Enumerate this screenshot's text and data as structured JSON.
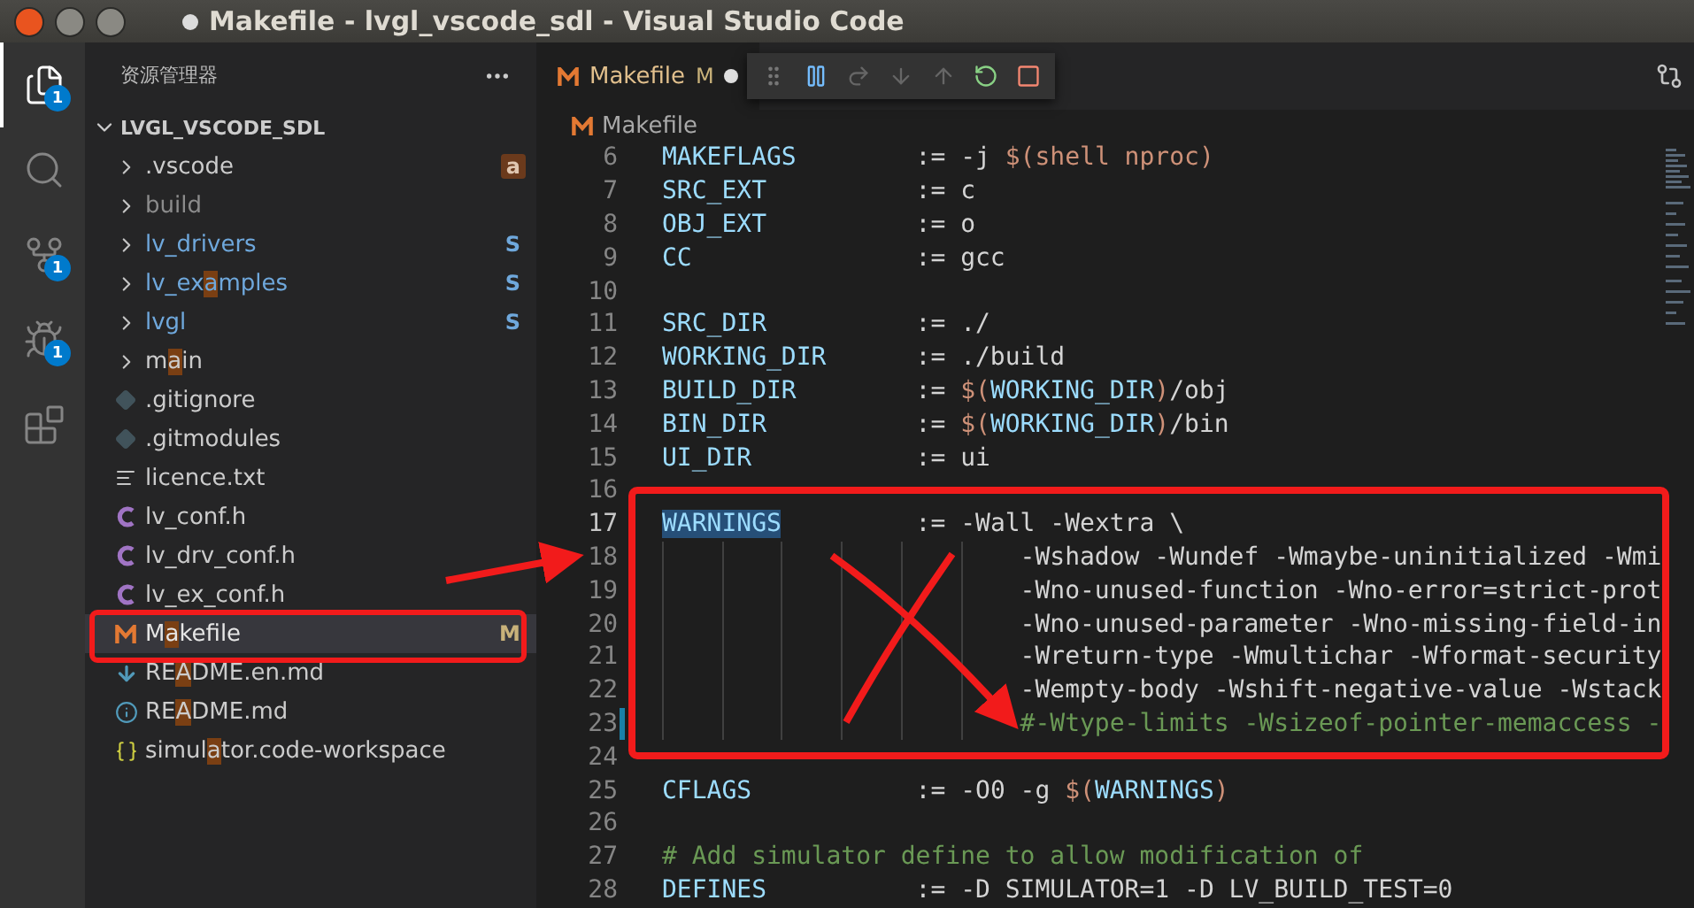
{
  "window": {
    "title": "Makefile - lvgl_vscode_sdl - Visual Studio Code",
    "unsaved": true
  },
  "activity_bar": [
    {
      "kind": "files",
      "selected": true,
      "badge": "1"
    },
    {
      "kind": "search",
      "selected": false
    },
    {
      "kind": "source-control",
      "selected": false,
      "badge": "1"
    },
    {
      "kind": "debug",
      "selected": false,
      "badge": "1"
    },
    {
      "kind": "extensions",
      "selected": false
    }
  ],
  "sidebar": {
    "title": "资源管理器",
    "section": {
      "title": "LVGL_VSCODE_SDL",
      "expanded": true
    },
    "items": [
      {
        "kind": "folder",
        "label_parts": [
          ".vscode"
        ],
        "ignored": false,
        "submodule": false,
        "modified": false,
        "decoration": "a",
        "selected": false
      },
      {
        "kind": "folder",
        "label_parts": [
          "build"
        ],
        "ignored": true,
        "submodule": false,
        "modified": false,
        "selected": false
      },
      {
        "kind": "folder",
        "label_parts": [
          "lv_drivers"
        ],
        "ignored": false,
        "submodule": true,
        "modified": false,
        "decoration": "S",
        "selected": false
      },
      {
        "kind": "folder",
        "label_parts": [
          "lv_ex",
          "a",
          "mples"
        ],
        "ignored": false,
        "submodule": true,
        "modified": false,
        "decoration": "S",
        "selected": false
      },
      {
        "kind": "folder",
        "label_parts": [
          "lvgl"
        ],
        "ignored": false,
        "submodule": true,
        "modified": false,
        "decoration": "S",
        "selected": false
      },
      {
        "kind": "folder",
        "label_parts": [
          "m",
          "a",
          "in"
        ],
        "ignored": false,
        "submodule": false,
        "modified": false,
        "selected": false
      },
      {
        "kind": "git",
        "label_parts": [
          ".gitignore"
        ],
        "ignored": false,
        "submodule": false,
        "modified": false,
        "selected": false
      },
      {
        "kind": "git",
        "label_parts": [
          ".gitmodules"
        ],
        "ignored": false,
        "submodule": false,
        "modified": false,
        "selected": false
      },
      {
        "kind": "text",
        "label_parts": [
          "licence.txt"
        ],
        "ignored": false,
        "submodule": false,
        "modified": false,
        "selected": false
      },
      {
        "kind": "c",
        "label_parts": [
          "lv_conf.h"
        ],
        "ignored": false,
        "submodule": false,
        "modified": false,
        "selected": false
      },
      {
        "kind": "c",
        "label_parts": [
          "lv_drv_conf.h"
        ],
        "ignored": false,
        "submodule": false,
        "modified": false,
        "selected": false
      },
      {
        "kind": "c",
        "label_parts": [
          "lv_ex_conf.h"
        ],
        "ignored": false,
        "submodule": false,
        "modified": false,
        "selected": false
      },
      {
        "kind": "make",
        "label_parts": [
          "M",
          "a",
          "kefile"
        ],
        "ignored": false,
        "submodule": false,
        "modified": true,
        "decoration": "M",
        "selected": true
      },
      {
        "kind": "download",
        "label_parts": [
          "RE",
          "A",
          "DME.en.md"
        ],
        "ignored": false,
        "submodule": false,
        "modified": false,
        "selected": false
      },
      {
        "kind": "info",
        "label_parts": [
          "RE",
          "A",
          "DME.md"
        ],
        "ignored": false,
        "submodule": false,
        "modified": false,
        "selected": false
      },
      {
        "kind": "json",
        "label_parts": [
          "simul",
          "a",
          "tor.code-workspace"
        ],
        "ignored": false,
        "submodule": false,
        "modified": false,
        "selected": false
      }
    ]
  },
  "tabs": [
    {
      "label": "Makefile",
      "decoration": "M",
      "unsaved": true,
      "selected": true
    }
  ],
  "breadcrumb": {
    "label": "Makefile"
  },
  "editor": {
    "lines": [
      {
        "number": "6",
        "current": false,
        "modified": false,
        "continuation": false,
        "tokens": [
          {
            "kind": "name",
            "text": "MAKEFLAGS"
          },
          {
            "kind": "plain",
            "text": "        := -j "
          },
          {
            "kind": "call",
            "text": "$(shell nproc)"
          }
        ]
      },
      {
        "number": "7",
        "current": false,
        "modified": false,
        "continuation": false,
        "tokens": [
          {
            "kind": "name",
            "text": "SRC_EXT"
          },
          {
            "kind": "plain",
            "text": "          := c"
          }
        ]
      },
      {
        "number": "8",
        "current": false,
        "modified": false,
        "continuation": false,
        "tokens": [
          {
            "kind": "name",
            "text": "OBJ_EXT"
          },
          {
            "kind": "plain",
            "text": "          := o"
          }
        ]
      },
      {
        "number": "9",
        "current": false,
        "modified": false,
        "continuation": false,
        "tokens": [
          {
            "kind": "name",
            "text": "CC"
          },
          {
            "kind": "plain",
            "text": "               := gcc"
          }
        ]
      },
      {
        "number": "10",
        "current": false,
        "modified": false,
        "continuation": false
      },
      {
        "number": "11",
        "current": false,
        "modified": false,
        "continuation": false,
        "tokens": [
          {
            "kind": "name",
            "text": "SRC_DIR"
          },
          {
            "kind": "plain",
            "text": "          := ./"
          }
        ]
      },
      {
        "number": "12",
        "current": false,
        "modified": false,
        "continuation": false,
        "tokens": [
          {
            "kind": "name",
            "text": "WORKING_DIR"
          },
          {
            "kind": "plain",
            "text": "      := ./build"
          }
        ]
      },
      {
        "number": "13",
        "current": false,
        "modified": false,
        "continuation": false,
        "tokens": [
          {
            "kind": "name",
            "text": "BUILD_DIR"
          },
          {
            "kind": "plain",
            "text": "        := "
          },
          {
            "kind": "call",
            "text": "$("
          },
          {
            "kind": "name",
            "text": "WORKING_DIR"
          },
          {
            "kind": "call",
            "text": ")"
          },
          {
            "kind": "plain",
            "text": "/obj"
          }
        ]
      },
      {
        "number": "14",
        "current": false,
        "modified": false,
        "continuation": false,
        "tokens": [
          {
            "kind": "name",
            "text": "BIN_DIR"
          },
          {
            "kind": "plain",
            "text": "          := "
          },
          {
            "kind": "call",
            "text": "$("
          },
          {
            "kind": "name",
            "text": "WORKING_DIR"
          },
          {
            "kind": "call",
            "text": ")"
          },
          {
            "kind": "plain",
            "text": "/bin"
          }
        ]
      },
      {
        "number": "15",
        "current": false,
        "modified": false,
        "continuation": false,
        "tokens": [
          {
            "kind": "name",
            "text": "UI_DIR"
          },
          {
            "kind": "plain",
            "text": "           := ui"
          }
        ]
      },
      {
        "number": "16",
        "current": false,
        "modified": false,
        "continuation": false
      },
      {
        "number": "17",
        "current": true,
        "modified": false,
        "continuation": false,
        "tokens": [
          {
            "kind": "match",
            "text": "WARNINGS"
          },
          {
            "kind": "plain",
            "text": "         := -Wall -Wextra \\"
          }
        ]
      },
      {
        "number": "18",
        "current": false,
        "modified": false,
        "continuation": true,
        "tokens": [
          {
            "kind": "plain",
            "text": "-Wshadow -Wundef -Wmaybe-uninitialized -Wmi"
          }
        ]
      },
      {
        "number": "19",
        "current": false,
        "modified": false,
        "continuation": true,
        "tokens": [
          {
            "kind": "plain",
            "text": "-Wno-unused-function -Wno-error=strict-prot"
          }
        ]
      },
      {
        "number": "20",
        "current": false,
        "modified": false,
        "continuation": true,
        "tokens": [
          {
            "kind": "plain",
            "text": "-Wno-unused-parameter -Wno-missing-field-in"
          }
        ]
      },
      {
        "number": "21",
        "current": false,
        "modified": false,
        "continuation": true,
        "tokens": [
          {
            "kind": "plain",
            "text": "-Wreturn-type -Wmultichar -Wformat-security"
          }
        ]
      },
      {
        "number": "22",
        "current": false,
        "modified": false,
        "continuation": true,
        "tokens": [
          {
            "kind": "plain",
            "text": "-Wempty-body -Wshift-negative-value -Wstack"
          }
        ]
      },
      {
        "number": "23",
        "current": false,
        "modified": true,
        "continuation": true,
        "tokens": [
          {
            "kind": "comment",
            "text": "#-Wtype-limits -Wsizeof-pointer-memaccess -"
          }
        ]
      },
      {
        "number": "24",
        "current": false,
        "modified": false,
        "continuation": false
      },
      {
        "number": "25",
        "current": false,
        "modified": false,
        "continuation": false,
        "tokens": [
          {
            "kind": "name",
            "text": "CFLAGS"
          },
          {
            "kind": "plain",
            "text": "           := -O0 -g "
          },
          {
            "kind": "call",
            "text": "$("
          },
          {
            "kind": "name",
            "text": "WARNINGS"
          },
          {
            "kind": "call",
            "text": ")"
          }
        ]
      },
      {
        "number": "26",
        "current": false,
        "modified": false,
        "continuation": false
      },
      {
        "number": "27",
        "current": false,
        "modified": false,
        "continuation": false,
        "tokens": [
          {
            "kind": "comment",
            "text": "# Add simulator define to allow modification of"
          }
        ]
      },
      {
        "number": "28",
        "current": false,
        "modified": false,
        "continuation": false,
        "tokens": [
          {
            "kind": "name",
            "text": "DEFINES"
          },
          {
            "kind": "plain",
            "text": "          := -D SIMULATOR=1 -D LV_BUILD_TEST=0"
          }
        ]
      }
    ]
  }
}
